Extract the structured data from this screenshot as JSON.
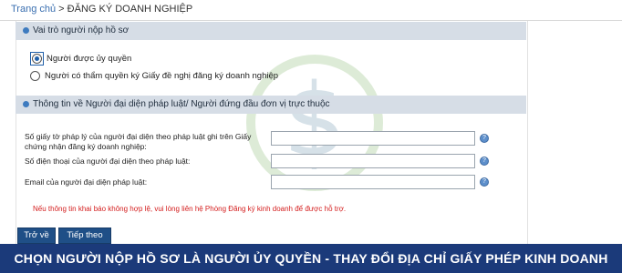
{
  "breadcrumb": {
    "home": "Trang chủ",
    "separator": " > ",
    "current": "ĐĂNG KÝ DOANH NGHIỆP"
  },
  "section1": {
    "title": "Vai trò người nộp hồ sơ",
    "options": [
      {
        "label": "Người được ủy quyền",
        "selected": true
      },
      {
        "label": "Người có thẩm quyền ký Giấy đề nghị đăng ký doanh nghiệp",
        "selected": false
      }
    ]
  },
  "section2": {
    "title": "Thông tin về Người đại diện pháp luật/ Người đứng đầu đơn vị trực thuộc",
    "fields": [
      {
        "label": "Số giấy tờ pháp lý của người đại diện theo pháp luật ghi trên Giấy chứng nhận đăng ký doanh nghiệp:",
        "value": ""
      },
      {
        "label": "Số điện thoại của người đại diện theo pháp luật:",
        "value": ""
      },
      {
        "label": "Email của người đại diện pháp luật:",
        "value": ""
      }
    ],
    "note": "Nếu thông tin khai báo không hợp lệ, vui lòng liên hệ Phòng Đăng ký kinh doanh để được hỗ trợ."
  },
  "buttons": {
    "back": "Trở về",
    "next": "Tiếp theo"
  },
  "banner": "CHỌN NGƯỜI NỘP HỒ SƠ LÀ NGƯỜI ỦY QUYỀN - THAY ĐỔI ĐỊA CHỈ GIẤY PHÉP KINH DOANH",
  "help_icon": "?",
  "colors": {
    "section_header": "#d6dde6",
    "button": "#1f4f87",
    "note": "#d41e1e",
    "banner": "#1b3a7a"
  }
}
